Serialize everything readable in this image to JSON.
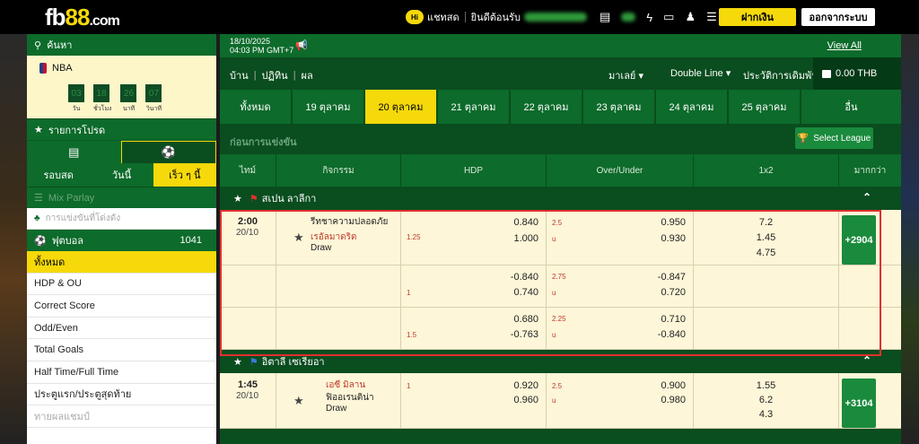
{
  "header": {
    "logo_prefix": "fb",
    "logo_number": "88",
    "logo_suffix": ".com",
    "hi_badge": "Hi",
    "chat_label": "แชทสด",
    "welcome_label": "ยินดีต้อนรับ",
    "deposit_label": "ฝากเงิน",
    "logout_label": "ออกจากระบบ"
  },
  "sidebar": {
    "search_label": "ค้นหา",
    "nba_label": "NBA",
    "countdown": [
      {
        "value": "03",
        "label": "วัน"
      },
      {
        "value": "18",
        "label": "ชั่วโมง"
      },
      {
        "value": "26",
        "label": "นาที"
      },
      {
        "value": "07",
        "label": "วินาที"
      }
    ],
    "favorites_label": "รายการโปรด",
    "period_tabs": [
      "รอบสด",
      "วันนี้",
      "เร็ว ๆ นี้"
    ],
    "mix_parlay_label": "Mix Parlay",
    "parlay_placeholder": "การแข่งขันที่โด่งดัง",
    "football_label": "ฟุตบอล",
    "football_count": "1041",
    "menu": [
      "ทั้งหมด",
      "HDP & OU",
      "Correct Score",
      "Odd/Even",
      "Total Goals",
      "Half Time/Full Time",
      "ประตูแรก/ประตูสุดท้าย",
      "ทายผลแชมป์"
    ]
  },
  "main": {
    "date": "18/10/2025",
    "time": "04:03 PM GMT+7",
    "view_all": "View All",
    "nav": [
      "บ้าน",
      "ปฏิทิน",
      "ผล"
    ],
    "dropdown_malay": "มาเลย์",
    "dropdown_line": "Double Line",
    "bet_history": "ประวัติการเดิมพัน",
    "balance": "0.00 THB",
    "date_tabs": [
      "ทั้งหมด",
      "19 ตุลาคม",
      "20 ตุลาคม",
      "21 ตุลาคม",
      "22 ตุลาคม",
      "23 ตุลาคม",
      "24 ตุลาคม",
      "25 ตุลาคม",
      "อื่น"
    ],
    "pre_match_title": "ก่อนการแข่งขัน",
    "select_league": "Select League",
    "columns": [
      "ไทม์",
      "กิจกรรม",
      "HDP",
      "Over/Under",
      "1x2",
      "มากกว่า"
    ],
    "leagues": [
      {
        "name": "สเปน ลาลีกา",
        "match": {
          "time": "2:00",
          "date": "20/10",
          "home": "รีทชาความปลอดภัย",
          "away": "เรอัลมาดริด",
          "draw": "Draw",
          "more": "+2904",
          "rows": [
            {
              "hdp_h": "",
              "hdp_a": "1.25",
              "hdp_o1": "0.840",
              "hdp_o2": "1.000",
              "ou_l": "2.5",
              "ou_u": "u",
              "ou_o1": "0.950",
              "ou_o2": "0.930",
              "x1": "7.2",
              "x2": "1.45",
              "x3": "4.75"
            },
            {
              "hdp_h": "",
              "hdp_a": "1",
              "hdp_o1": "-0.840",
              "hdp_o2": "0.740",
              "ou_l": "2.75",
              "ou_u": "u",
              "ou_o1": "-0.847",
              "ou_o2": "0.720"
            },
            {
              "hdp_h": "",
              "hdp_a": "1.5",
              "hdp_o1": "0.680",
              "hdp_o2": "-0.763",
              "ou_l": "2.25",
              "ou_u": "u",
              "ou_o1": "0.710",
              "ou_o2": "-0.840"
            }
          ]
        }
      },
      {
        "name": "อิตาลี เซเรียอา",
        "match": {
          "time": "1:45",
          "date": "20/10",
          "home": "เอซี มิลาน",
          "away": "ฟิออเรนติน่า",
          "draw": "Draw",
          "more": "+3104",
          "rows": [
            {
              "hdp_h": "1",
              "hdp_a": "",
              "hdp_o1": "0.920",
              "hdp_o2": "0.960",
              "ou_l": "2.5",
              "ou_u": "u",
              "ou_o1": "0.900",
              "ou_o2": "0.980",
              "x1": "1.55",
              "x2": "6.2",
              "x3": "4.3"
            }
          ]
        }
      }
    ]
  }
}
